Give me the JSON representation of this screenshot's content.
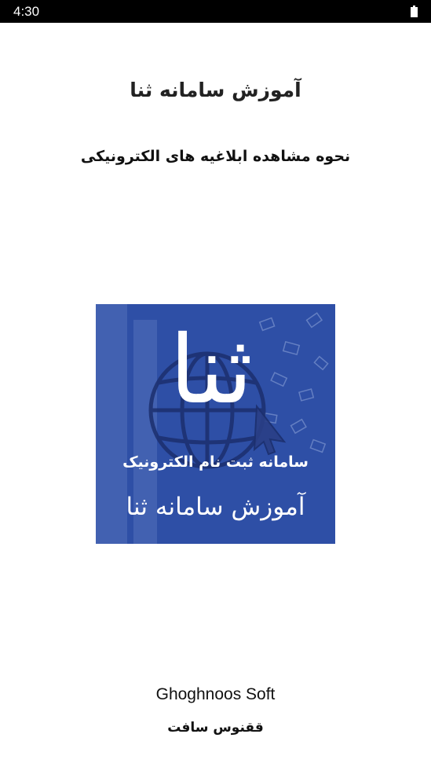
{
  "status_bar": {
    "time": "4:30",
    "battery_icon": "battery-full-icon"
  },
  "splash": {
    "title": "آموزش سامانه ثنا",
    "subtitle": "نحوه مشاهده ابلاغیه های الکترونیکی",
    "logo": {
      "letter": "ثنا",
      "caption_small": "سامانه ثبت نام الکترونیک",
      "caption_large": "آموزش سامانه ثنا",
      "background_color": "#2e4fa6"
    },
    "company_en": "Ghoghnoos Soft",
    "company_fa": "ققنوس سافت"
  }
}
